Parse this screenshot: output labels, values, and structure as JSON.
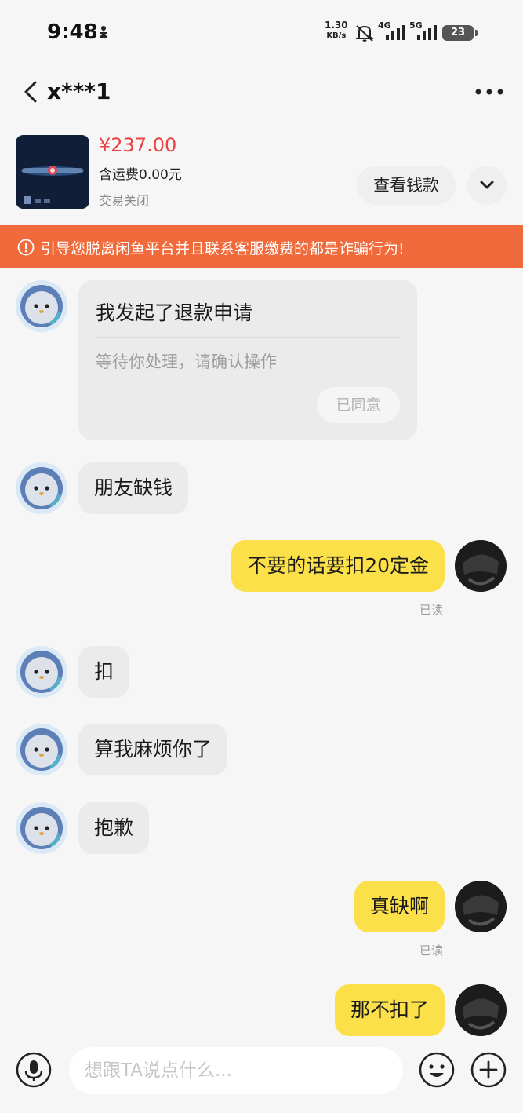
{
  "status_bar": {
    "time": "9:48",
    "speed_value": "1.30",
    "speed_unit": "KB/s",
    "net_4g": "4G",
    "net_5g": "5G",
    "battery": "23"
  },
  "header": {
    "back_icon": "chevron-left-icon",
    "title": "x***1",
    "more_icon": "more-horizontal-icon"
  },
  "product": {
    "price": "¥237.00",
    "shipping": "含运费0.00元",
    "status": "交易关闭",
    "view_payment_label": "查看钱款",
    "expand_icon": "chevron-down-icon"
  },
  "warning": {
    "text": "引导您脱离闲鱼平台并且联系客服缴费的都是诈骗行为!",
    "icon": "info-circle-icon",
    "color": "#f06a3b"
  },
  "messages": [
    {
      "side": "left",
      "type": "refund_card",
      "title": "我发起了退款申请",
      "subtitle": "等待你处理，请确认操作",
      "button": "已同意"
    },
    {
      "side": "left",
      "text": "朋友缺钱"
    },
    {
      "side": "right",
      "text": "不要的话要扣20定金",
      "read": "已读"
    },
    {
      "side": "left",
      "text": "扣"
    },
    {
      "side": "left",
      "text": "算我麻烦你了"
    },
    {
      "side": "left",
      "text": "抱歉"
    },
    {
      "side": "right",
      "text": "真缺啊",
      "read": "已读"
    },
    {
      "side": "right",
      "text": "那不扣了"
    }
  ],
  "input_bar": {
    "placeholder": "想跟TA说点什么...",
    "mic_icon": "microphone-icon",
    "emoji_icon": "smiley-icon",
    "plus_icon": "plus-circle-icon"
  },
  "colors": {
    "own_bubble": "#fbe04a",
    "other_bubble": "#ebebeb",
    "price": "#e8413f",
    "background": "#f6f6f6"
  }
}
